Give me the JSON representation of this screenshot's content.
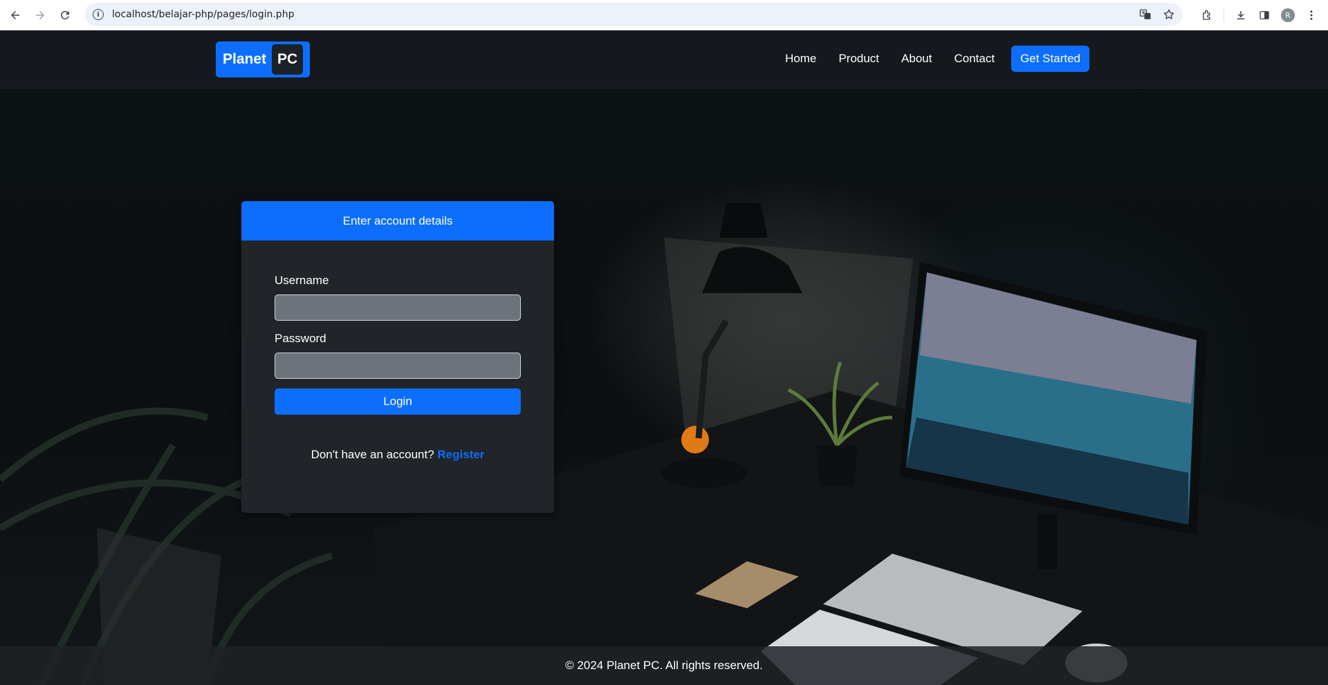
{
  "browser": {
    "url": "localhost/belajar-php/pages/login.php",
    "avatar_initial": "R"
  },
  "nav": {
    "logo_word1": "Planet",
    "logo_word2": "PC",
    "links": [
      "Home",
      "Product",
      "About",
      "Contact"
    ],
    "cta": "Get Started"
  },
  "login": {
    "header": "Enter account details",
    "username_label": "Username",
    "password_label": "Password",
    "username_value": "",
    "password_value": "",
    "submit": "Login",
    "register_prompt": "Don't have an account?",
    "register_link": "Register"
  },
  "footer": {
    "text": "© 2024 Planet PC. All rights reserved."
  },
  "colors": {
    "primary": "#0d6efd",
    "card": "#212429",
    "input": "#6c737b"
  }
}
